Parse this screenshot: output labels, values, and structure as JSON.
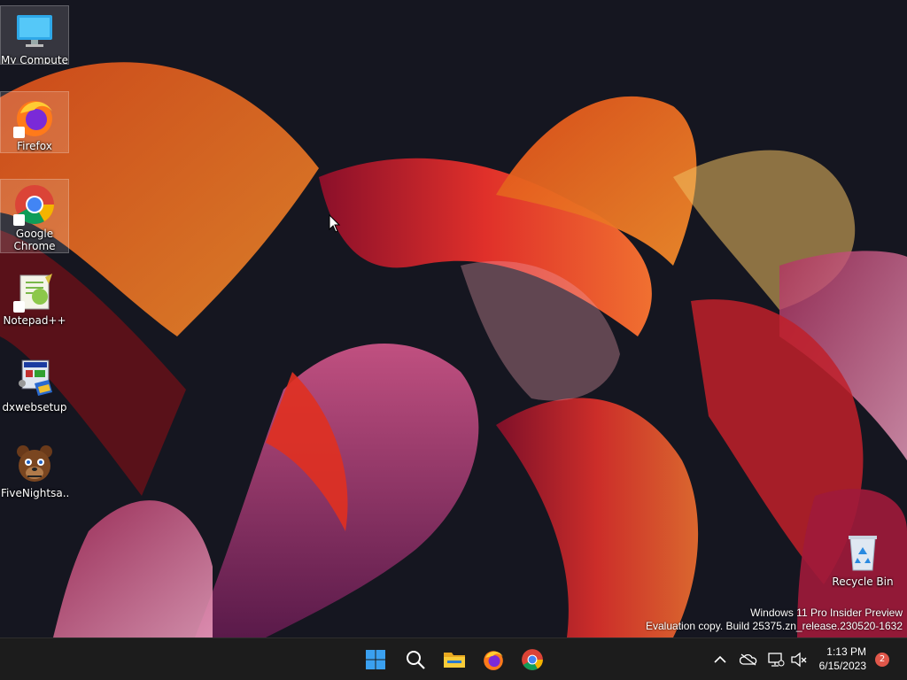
{
  "desktop": {
    "icons": [
      {
        "label": "My Computer",
        "icon": "monitor-icon",
        "selected": true
      },
      {
        "label": "Firefox",
        "icon": "firefox-icon",
        "selected": true
      },
      {
        "label": "Google Chrome",
        "icon": "chrome-icon",
        "selected": true
      },
      {
        "label": "Notepad++",
        "icon": "notepadpp-icon",
        "selected": false
      },
      {
        "label": "dxwebsetup",
        "icon": "installer-icon",
        "selected": false
      },
      {
        "label": "FiveNightsa...",
        "icon": "freddy-icon",
        "selected": false
      }
    ],
    "recycle_bin": {
      "label": "Recycle Bin",
      "icon": "recycle-bin-icon"
    }
  },
  "watermark": {
    "line1": "Windows 11 Pro Insider Preview",
    "line2": "Evaluation copy. Build 25375.zn_release.230520-1632"
  },
  "taskbar": {
    "pinned": [
      {
        "name": "start",
        "icon": "windows-logo-icon"
      },
      {
        "name": "search",
        "icon": "search-icon"
      },
      {
        "name": "file-explorer",
        "icon": "folder-icon"
      },
      {
        "name": "firefox",
        "icon": "firefox-icon"
      },
      {
        "name": "chrome",
        "icon": "chrome-icon"
      }
    ],
    "tray": {
      "icons": [
        "chevron-up-icon",
        "onedrive-offline-icon",
        "network-icon",
        "volume-muted-icon"
      ],
      "time": "1:13 PM",
      "date": "6/15/2023",
      "notification_count": "2"
    }
  },
  "colors": {
    "taskbar_bg": "#1c1c1c",
    "windows_blue": "#3aa0f0",
    "badge_red": "#e0574a"
  }
}
